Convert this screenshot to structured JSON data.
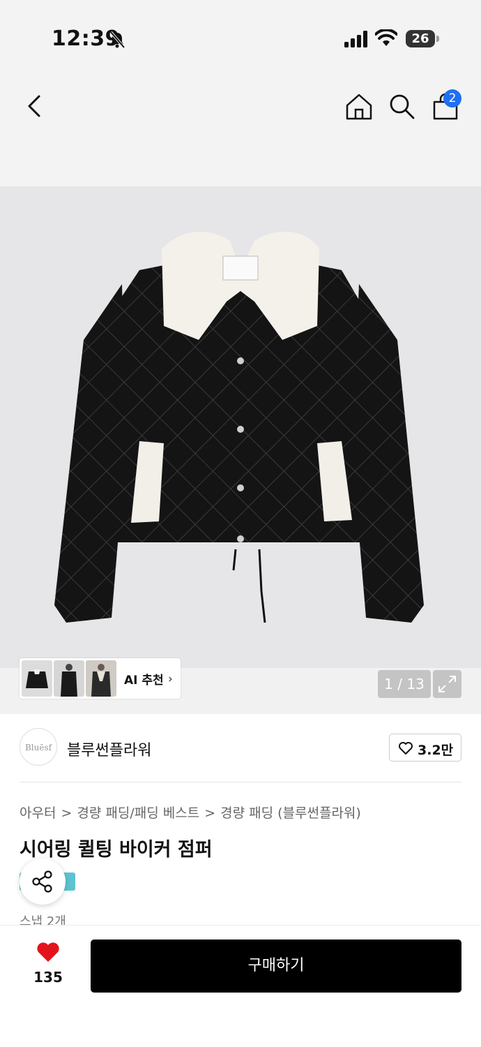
{
  "status_bar": {
    "time": "12:39",
    "battery": "26"
  },
  "nav": {
    "cart_count": "2"
  },
  "gallery": {
    "ai_label": "AI 추천",
    "page_indicator": "1 / 13"
  },
  "brand": {
    "logo_text": "Bluēsf",
    "name": "블루썬플라워",
    "likes": "3.2만"
  },
  "breadcrumb": [
    "아우터",
    "경량 패딩/패딩 베스트",
    "경량 패딩 (블루썬플라워)"
  ],
  "breadcrumb_separator": ">",
  "product": {
    "title": "시어링 퀼팅 바이커 점퍼",
    "snap_count": "스냅 2개"
  },
  "bottom_bar": {
    "wish_count": "135",
    "buy_label": "구매하기"
  },
  "colors": {
    "accent_blue": "#1e6ff2",
    "heart_red": "#e3131b",
    "tag_teal": "#5ec3d1"
  }
}
